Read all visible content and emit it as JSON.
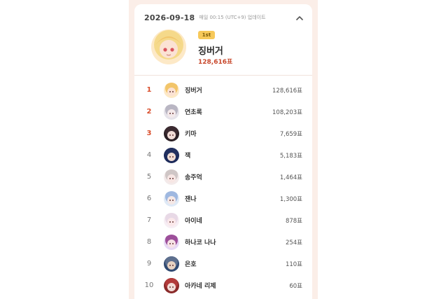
{
  "header": {
    "date": "2026-09-18",
    "update_text": "매일 00:15 (UTC+9) 업데이트"
  },
  "top": {
    "badge": "1st",
    "name": "징버거",
    "votes": "128,616표"
  },
  "ranking": [
    {
      "rank": "1",
      "name": "징버거",
      "votes": "128,616표"
    },
    {
      "rank": "2",
      "name": "연초록",
      "votes": "108,203표"
    },
    {
      "rank": "3",
      "name": "키마",
      "votes": "7,659표"
    },
    {
      "rank": "4",
      "name": "잭",
      "votes": "5,183표"
    },
    {
      "rank": "5",
      "name": "송주억",
      "votes": "1,464표"
    },
    {
      "rank": "6",
      "name": "잰나",
      "votes": "1,300표"
    },
    {
      "rank": "7",
      "name": "아이네",
      "votes": "878표"
    },
    {
      "rank": "8",
      "name": "하나코 나나",
      "votes": "254표"
    },
    {
      "rank": "9",
      "name": "은호",
      "votes": "110표"
    },
    {
      "rank": "10",
      "name": "아카네 리제",
      "votes": "60표"
    }
  ],
  "colors": {
    "panel_bg": "#fbeee8",
    "accent_red": "#c8482c",
    "badge_gold": "#f7c95a"
  },
  "icons": {
    "collapse": "chevron-up-icon",
    "avatar": "avatar-icon"
  }
}
